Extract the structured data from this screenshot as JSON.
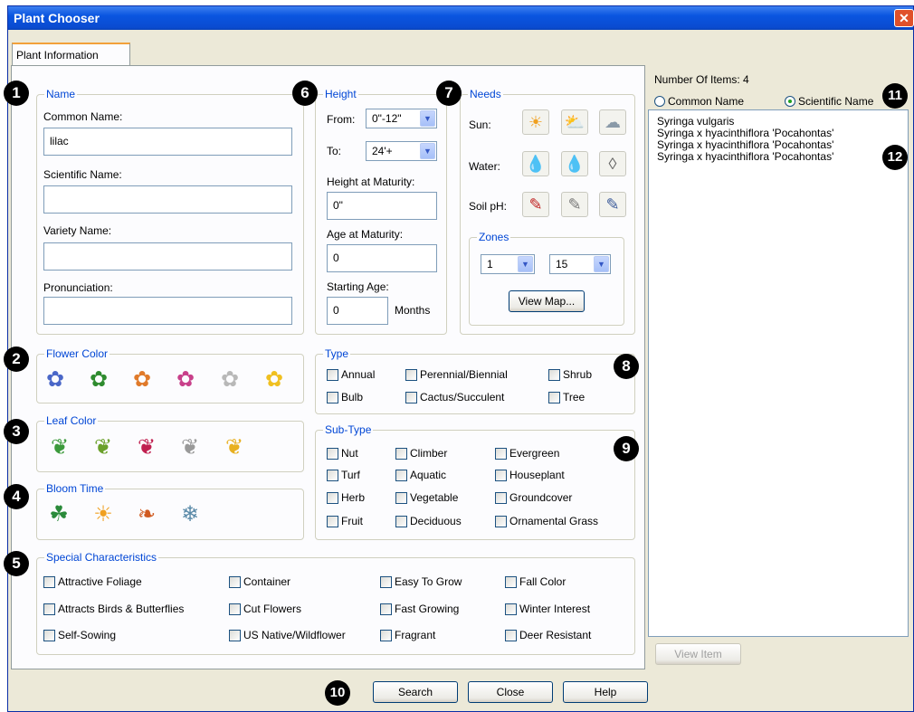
{
  "window": {
    "title": "Plant Chooser",
    "close_glyph": "✕"
  },
  "tab": {
    "label": "Plant Information"
  },
  "name_group": {
    "title": "Name",
    "common_label": "Common Name:",
    "common_value": "lilac",
    "scientific_label": "Scientific Name:",
    "scientific_value": "",
    "variety_label": "Variety Name:",
    "variety_value": "",
    "pronunciation_label": "Pronunciation:",
    "pronunciation_value": ""
  },
  "height_group": {
    "title": "Height",
    "from_label": "From:",
    "from_value": "0\"-12\"",
    "to_label": "To:",
    "to_value": "24'+",
    "height_maturity_label": "Height at Maturity:",
    "height_maturity_value": "0\"",
    "age_maturity_label": "Age at Maturity:",
    "age_maturity_value": "0",
    "starting_age_label": "Starting Age:",
    "starting_age_value": "0",
    "months_label": "Months"
  },
  "needs_group": {
    "title": "Needs",
    "sun_label": "Sun:",
    "water_label": "Water:",
    "soil_label": "Soil pH:",
    "sun_icons": [
      "full-sun-icon",
      "partial-sun-icon",
      "shade-icon"
    ],
    "water_icons": [
      "high-water-icon",
      "medium-water-icon",
      "low-water-icon"
    ],
    "soil_icons": [
      "acid-soil-icon",
      "neutral-soil-icon",
      "alkaline-soil-icon"
    ],
    "zones_title": "Zones",
    "zone_from": "1",
    "zone_to": "15",
    "view_map": "View Map..."
  },
  "flower_color": {
    "title": "Flower Color",
    "colors": [
      "#4a67c8",
      "#2e8b2e",
      "#e07a2a",
      "#c8408a",
      "#c8c8c8",
      "#f0c020"
    ]
  },
  "leaf_color": {
    "title": "Leaf Color",
    "colors": [
      "#3c9a3c",
      "#6aa02a",
      "#c02050",
      "#e8e8e8",
      "#e8b020"
    ]
  },
  "bloom_time": {
    "title": "Bloom Time",
    "icons": [
      "spring-icon",
      "summer-icon",
      "fall-icon",
      "winter-icon"
    ]
  },
  "type_group": {
    "title": "Type",
    "items": [
      "Annual",
      "Perennial/Biennial",
      "Shrub",
      "Bulb",
      "Cactus/Succulent",
      "Tree"
    ]
  },
  "subtype_group": {
    "title": "Sub-Type",
    "items": [
      "Nut",
      "Climber",
      "Evergreen",
      "Turf",
      "Aquatic",
      "Houseplant",
      "Herb",
      "Vegetable",
      "Groundcover",
      "Fruit",
      "Deciduous",
      "Ornamental Grass"
    ]
  },
  "special_group": {
    "title": "Special Characteristics",
    "items": [
      "Attractive Foliage",
      "Container",
      "Easy To Grow",
      "Fall Color",
      "Attracts Birds & Butterflies",
      "Cut Flowers",
      "Fast Growing",
      "Winter Interest",
      "Self-Sowing",
      "US Native/Wildflower",
      "Fragrant",
      "Deer Resistant"
    ]
  },
  "results": {
    "count_label": "Number Of Items: 4",
    "radio_common": "Common Name",
    "radio_scientific": "Scientific Name",
    "items": [
      "Syringa vulgaris",
      "Syringa x hyacinthiflora 'Pocahontas'",
      "Syringa x hyacinthiflora 'Pocahontas'",
      "Syringa x hyacinthiflora 'Pocahontas'"
    ],
    "view_item": "View Item"
  },
  "buttons": {
    "search": "Search",
    "close": "Close",
    "help": "Help"
  },
  "badges": [
    "1",
    "2",
    "3",
    "4",
    "5",
    "6",
    "7",
    "8",
    "9",
    "10",
    "11",
    "12"
  ]
}
